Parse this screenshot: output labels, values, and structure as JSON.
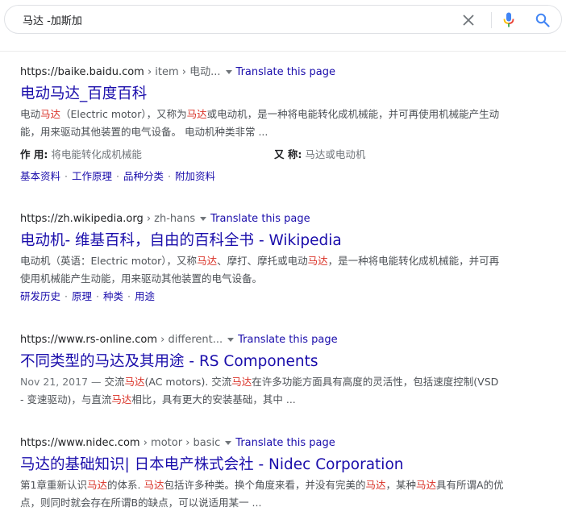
{
  "search": {
    "query": "马达 -加斯加"
  },
  "results": [
    {
      "site": "https://baike.baidu.com",
      "path": " › item › 电动...",
      "translate": "Translate this page",
      "title": "电动马达_百度百科",
      "snippet": [
        {
          "t": "电动",
          "hl": false
        },
        {
          "t": "马达",
          "hl": true
        },
        {
          "t": "（Electric motor），又称为",
          "hl": false
        },
        {
          "t": "马达",
          "hl": true
        },
        {
          "t": "或电动机，是一种将电能转化成机械能，并可再使用机械能产生动能，用来驱动其他装置的电气设备。 电动机种类非常 ...",
          "hl": false
        }
      ],
      "attrs": [
        {
          "key": "作 用:",
          "value": "将电能转化成机械能"
        },
        {
          "key": "又 称:",
          "value": "马达或电动机"
        }
      ],
      "sitelinks": [
        "基本资料",
        "工作原理",
        "品种分类",
        "附加资料"
      ]
    },
    {
      "site": "https://zh.wikipedia.org",
      "path": " › zh-hans",
      "translate": "Translate this page",
      "title": "电动机- 维基百科，自由的百科全书 - Wikipedia",
      "snippet": [
        {
          "t": "电动机（英语：Electric motor），又称",
          "hl": false
        },
        {
          "t": "马达",
          "hl": true
        },
        {
          "t": "、摩打、摩托或电动",
          "hl": false
        },
        {
          "t": "马达",
          "hl": true
        },
        {
          "t": "，是一种将电能转化成机械能，并可再使用机械能产生动能，用来驱动其他装置的电气设备。",
          "hl": false
        }
      ],
      "sitelinks": [
        "研发历史",
        "原理",
        "种类",
        "用途"
      ]
    },
    {
      "site": "https://www.rs-online.com",
      "path": " › different...",
      "translate": "Translate this page",
      "title": "不同类型的马达及其用途 - RS Components",
      "date": "Nov 21, 2017 — ",
      "snippet": [
        {
          "t": "交流",
          "hl": false
        },
        {
          "t": "马达",
          "hl": true
        },
        {
          "t": "(AC motors). 交流",
          "hl": false
        },
        {
          "t": "马达",
          "hl": true
        },
        {
          "t": "在许多功能方面具有高度的灵活性，包括速度控制(VSD - 变速驱动)，与直流",
          "hl": false
        },
        {
          "t": "马达",
          "hl": true
        },
        {
          "t": "相比，具有更大的安装基础，其中 ...",
          "hl": false
        }
      ]
    },
    {
      "site": "https://www.nidec.com",
      "path": " › motor › basic",
      "translate": "Translate this page",
      "title": "马达的基础知识| 日本电产株式会社 - Nidec Corporation",
      "snippet": [
        {
          "t": "第1章重新认识",
          "hl": false
        },
        {
          "t": "马达",
          "hl": true
        },
        {
          "t": "的体系. ",
          "hl": false
        },
        {
          "t": "马达",
          "hl": true
        },
        {
          "t": "包括许多种类。换个角度来看，并没有完美的",
          "hl": false
        },
        {
          "t": "马达",
          "hl": true
        },
        {
          "t": "，某种",
          "hl": false
        },
        {
          "t": "马达",
          "hl": true
        },
        {
          "t": "具有所谓A的优点，则同时就会存在所谓B的缺点，可以说适用某一 ...",
          "hl": false
        }
      ]
    }
  ],
  "icons": {
    "clear": "close-icon",
    "mic": "microphone-icon",
    "search": "search-icon"
  },
  "colors": {
    "link": "#1a0dab",
    "highlight": "#d93025",
    "text": "#4d5156",
    "mic_blue": "#4285f4",
    "mic_red": "#ea4335",
    "mic_yellow": "#fbbc05",
    "mic_green": "#34a853"
  }
}
